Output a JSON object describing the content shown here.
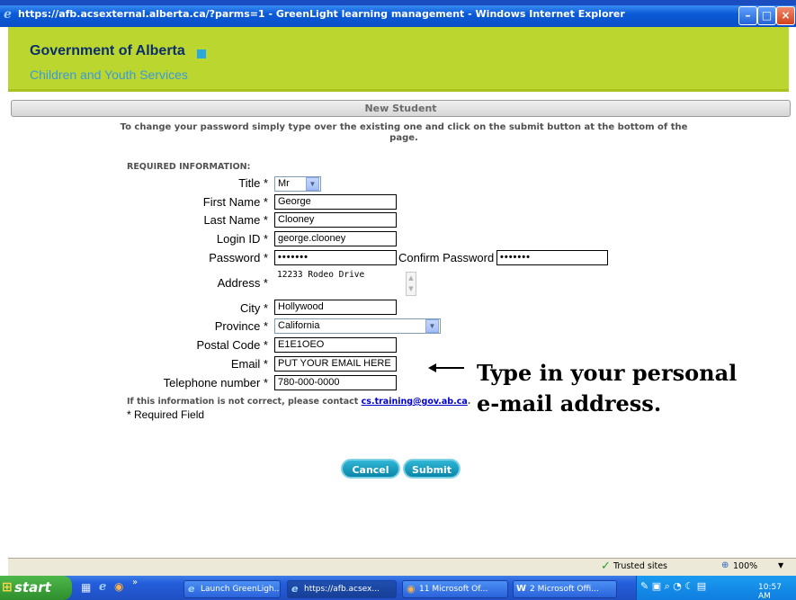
{
  "window": {
    "title": "https://afb.acsexternal.alberta.ca/?parms=1 - GreenLight learning management - Windows Internet Explorer",
    "controls": [
      "minimize",
      "maximize",
      "close"
    ]
  },
  "banner": {
    "title": "Government of Alberta",
    "subtitle": "Children and Youth Services"
  },
  "section": {
    "title": "New Student"
  },
  "instructions": "To change your password simply type over the existing one and click on the submit button at the bottom of the page.",
  "form": {
    "required_header": "REQUIRED INFORMATION:",
    "title_label": "Title *",
    "title_value": "Mr",
    "first_name_label": "First Name *",
    "first_name_value": "George",
    "last_name_label": "Last Name *",
    "last_name_value": "Clooney",
    "login_label": "Login ID *",
    "login_value": "george.clooney",
    "password_label": "Password *",
    "password_value": "•••••••",
    "confirm_label": "Confirm Password",
    "confirm_value": "•••••••",
    "address_label": "Address *",
    "address_value": "12233 Rodeo Drive",
    "city_label": "City *",
    "city_value": "Hollywood",
    "province_label": "Province *",
    "province_value": "California",
    "postal_label": "Postal Code *",
    "postal_value": "E1E1OEO",
    "email_label": "Email *",
    "email_value": "PUT YOUR EMAIL HERE",
    "phone_label": "Telephone number *",
    "phone_value": "780-000-0000"
  },
  "notes": {
    "contact_prefix": "If this information is not correct, please contact",
    "contact_email": "cs.training@gov.ab.ca",
    "contact_suffix": ".",
    "required": "* Required Field"
  },
  "buttons": {
    "cancel": "Cancel",
    "submit": "Submit"
  },
  "annotation": {
    "line1": "Type in your personal",
    "line2": "e-mail address."
  },
  "status": {
    "zone": "Trusted sites",
    "zoom": "100%"
  },
  "taskbar": {
    "start": "start",
    "tasks": [
      "Launch GreenLigh...",
      "https://afb.acsex...",
      "11 Microsoft Of...",
      "2 Microsoft Offi..."
    ],
    "clock": "10:57 AM"
  },
  "colors": {
    "banner": "#bcd630",
    "brand_blue": "#0b2f6b",
    "button": "#0a85a8"
  }
}
